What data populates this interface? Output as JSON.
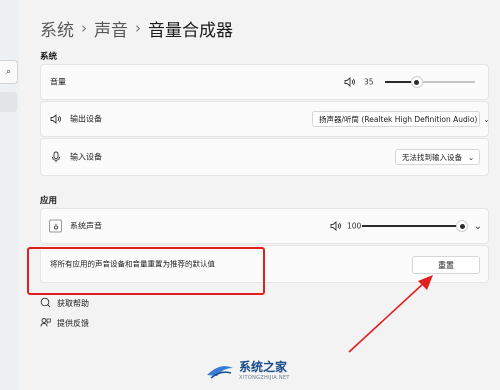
{
  "breadcrumb": {
    "level1": "系统",
    "level2": "声音",
    "level3": "音量合成器"
  },
  "sidebar": {
    "search_icon_glyph": "⌕"
  },
  "system_section": {
    "title": "系统",
    "volume": {
      "label": "音量",
      "value": "35",
      "level": 0.35
    },
    "output": {
      "label": "输出设备",
      "selected": "扬声器/听筒 (Realtek High Definition Audio)"
    },
    "input": {
      "label": "输入设备",
      "selected": "无法找到输入设备"
    }
  },
  "apps_section": {
    "title": "应用",
    "system_sounds": {
      "label": "系统声音",
      "value": "100",
      "level": 1.0
    },
    "reset": {
      "text": "将所有应用的声音设备和音量重置为推荐的默认值",
      "button": "重置"
    }
  },
  "links": {
    "help": "获取帮助",
    "feedback": "提供反馈"
  },
  "watermark": {
    "name": "系统之家",
    "url": "XITONGZHIJIA.NET"
  },
  "colors": {
    "highlight_box": "#e02020",
    "arrow": "#e02020",
    "watermark": "#1a4e8a"
  }
}
